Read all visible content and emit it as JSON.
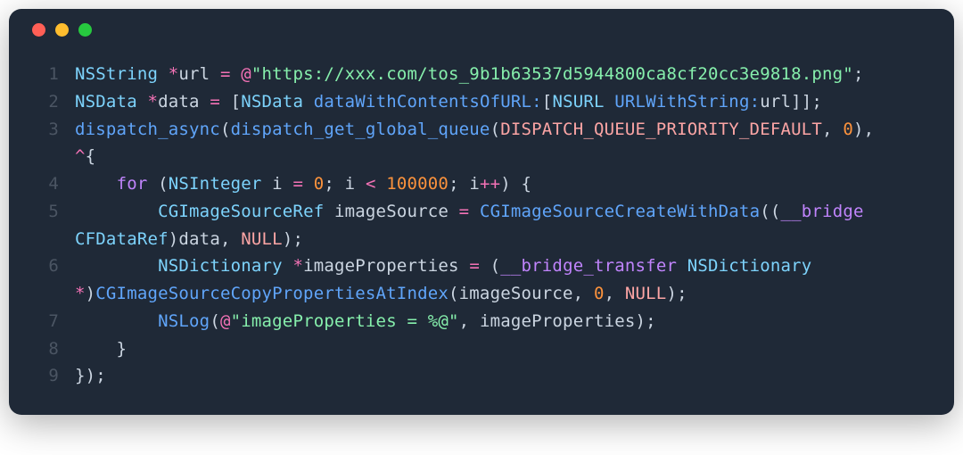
{
  "window": {
    "traffic": [
      "red",
      "yellow",
      "green"
    ]
  },
  "code": {
    "lines": [
      {
        "n": "1",
        "tokens": [
          {
            "c": "tk-type",
            "t": "NSString"
          },
          {
            "c": "tk-punc",
            "t": " "
          },
          {
            "c": "tk-op",
            "t": "*"
          },
          {
            "c": "tk-punc",
            "t": "url "
          },
          {
            "c": "tk-op",
            "t": "="
          },
          {
            "c": "tk-punc",
            "t": " "
          },
          {
            "c": "tk-op",
            "t": "@"
          },
          {
            "c": "tk-str",
            "t": "\"https://xxx.com/tos_9b1b63537d5944800ca8cf20cc3e9818.png\""
          },
          {
            "c": "tk-punc",
            "t": ";"
          }
        ]
      },
      {
        "n": "2",
        "tokens": [
          {
            "c": "tk-type",
            "t": "NSData"
          },
          {
            "c": "tk-punc",
            "t": " "
          },
          {
            "c": "tk-op",
            "t": "*"
          },
          {
            "c": "tk-punc",
            "t": "data "
          },
          {
            "c": "tk-op",
            "t": "="
          },
          {
            "c": "tk-punc",
            "t": " ["
          },
          {
            "c": "tk-type",
            "t": "NSData"
          },
          {
            "c": "tk-punc",
            "t": " "
          },
          {
            "c": "tk-func",
            "t": "dataWithContentsOfURL:"
          },
          {
            "c": "tk-punc",
            "t": "["
          },
          {
            "c": "tk-type",
            "t": "NSURL"
          },
          {
            "c": "tk-punc",
            "t": " "
          },
          {
            "c": "tk-func",
            "t": "URLWithString:"
          },
          {
            "c": "tk-punc",
            "t": "url]];"
          }
        ]
      },
      {
        "n": "3",
        "tokens": [
          {
            "c": "tk-func",
            "t": "dispatch_async"
          },
          {
            "c": "tk-punc",
            "t": "("
          },
          {
            "c": "tk-func",
            "t": "dispatch_get_global_queue"
          },
          {
            "c": "tk-punc",
            "t": "("
          },
          {
            "c": "tk-const",
            "t": "DISPATCH_QUEUE_PRIORITY_DEFAULT"
          },
          {
            "c": "tk-punc",
            "t": ", "
          },
          {
            "c": "tk-num",
            "t": "0"
          },
          {
            "c": "tk-punc",
            "t": "), "
          }
        ]
      },
      {
        "n": "",
        "cont": true,
        "tokens": [
          {
            "c": "tk-op",
            "t": "^"
          },
          {
            "c": "tk-punc",
            "t": "{"
          }
        ]
      },
      {
        "n": "4",
        "tokens": [
          {
            "c": "tk-punc",
            "t": "    "
          },
          {
            "c": "tk-kw",
            "t": "for"
          },
          {
            "c": "tk-punc",
            "t": " ("
          },
          {
            "c": "tk-type",
            "t": "NSInteger"
          },
          {
            "c": "tk-punc",
            "t": " i "
          },
          {
            "c": "tk-op",
            "t": "="
          },
          {
            "c": "tk-punc",
            "t": " "
          },
          {
            "c": "tk-num",
            "t": "0"
          },
          {
            "c": "tk-punc",
            "t": "; i "
          },
          {
            "c": "tk-op",
            "t": "<"
          },
          {
            "c": "tk-punc",
            "t": " "
          },
          {
            "c": "tk-num",
            "t": "100000"
          },
          {
            "c": "tk-punc",
            "t": "; i"
          },
          {
            "c": "tk-op",
            "t": "++"
          },
          {
            "c": "tk-punc",
            "t": ") {"
          }
        ]
      },
      {
        "n": "5",
        "tokens": [
          {
            "c": "tk-punc",
            "t": "        "
          },
          {
            "c": "tk-type",
            "t": "CGImageSourceRef"
          },
          {
            "c": "tk-punc",
            "t": " imageSource "
          },
          {
            "c": "tk-op",
            "t": "="
          },
          {
            "c": "tk-punc",
            "t": " "
          },
          {
            "c": "tk-func",
            "t": "CGImageSourceCreateWithData"
          },
          {
            "c": "tk-punc",
            "t": "(("
          },
          {
            "c": "tk-kw",
            "t": "__bridge"
          },
          {
            "c": "tk-punc",
            "t": " "
          }
        ]
      },
      {
        "n": "",
        "cont": true,
        "tokens": [
          {
            "c": "tk-type",
            "t": "CFDataRef"
          },
          {
            "c": "tk-punc",
            "t": ")data, "
          },
          {
            "c": "tk-const",
            "t": "NULL"
          },
          {
            "c": "tk-punc",
            "t": ");"
          }
        ]
      },
      {
        "n": "6",
        "tokens": [
          {
            "c": "tk-punc",
            "t": "        "
          },
          {
            "c": "tk-type",
            "t": "NSDictionary"
          },
          {
            "c": "tk-punc",
            "t": " "
          },
          {
            "c": "tk-op",
            "t": "*"
          },
          {
            "c": "tk-punc",
            "t": "imageProperties "
          },
          {
            "c": "tk-op",
            "t": "="
          },
          {
            "c": "tk-punc",
            "t": " ("
          },
          {
            "c": "tk-kw",
            "t": "__bridge_transfer"
          },
          {
            "c": "tk-punc",
            "t": " "
          },
          {
            "c": "tk-type",
            "t": "NSDictionary"
          },
          {
            "c": "tk-punc",
            "t": " "
          }
        ]
      },
      {
        "n": "",
        "cont": true,
        "tokens": [
          {
            "c": "tk-op",
            "t": "*"
          },
          {
            "c": "tk-punc",
            "t": ")"
          },
          {
            "c": "tk-func",
            "t": "CGImageSourceCopyPropertiesAtIndex"
          },
          {
            "c": "tk-punc",
            "t": "(imageSource, "
          },
          {
            "c": "tk-num",
            "t": "0"
          },
          {
            "c": "tk-punc",
            "t": ", "
          },
          {
            "c": "tk-const",
            "t": "NULL"
          },
          {
            "c": "tk-punc",
            "t": ");"
          }
        ]
      },
      {
        "n": "7",
        "tokens": [
          {
            "c": "tk-punc",
            "t": "        "
          },
          {
            "c": "tk-func",
            "t": "NSLog"
          },
          {
            "c": "tk-punc",
            "t": "("
          },
          {
            "c": "tk-op",
            "t": "@"
          },
          {
            "c": "tk-str",
            "t": "\"imageProperties = %@\""
          },
          {
            "c": "tk-punc",
            "t": ", imageProperties);"
          }
        ]
      },
      {
        "n": "8",
        "tokens": [
          {
            "c": "tk-punc",
            "t": "    }"
          }
        ]
      },
      {
        "n": "9",
        "tokens": [
          {
            "c": "tk-punc",
            "t": "});"
          }
        ]
      }
    ]
  }
}
